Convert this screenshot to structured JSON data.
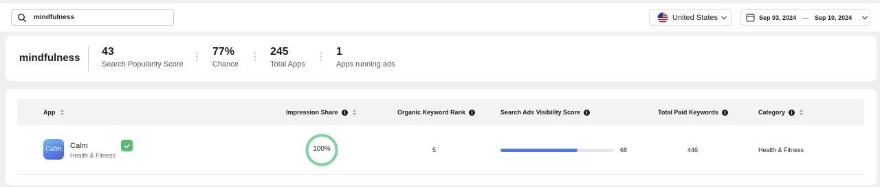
{
  "search": {
    "value": "mindfulness",
    "icon": "search-icon"
  },
  "country": {
    "label": "United States",
    "icon": "us-flag-icon"
  },
  "date_range": {
    "start": "Sep 03, 2024",
    "separator": "—",
    "end": "Sep 10, 2024"
  },
  "summary": {
    "keyword": "mindfulness",
    "metrics": [
      {
        "value": "43",
        "label": "Search Popularity Score"
      },
      {
        "value": "77%",
        "label": "Chance"
      },
      {
        "value": "245",
        "label": "Total Apps"
      },
      {
        "value": "1",
        "label": "Apps running ads"
      }
    ]
  },
  "table": {
    "columns": {
      "app": "App",
      "impression_share": "Impression Share",
      "organic_rank": "Organic Keyword Rank",
      "visibility": "Search Ads Visibility Score",
      "paid_keywords": "Total Paid Keywords",
      "category": "Category"
    },
    "rows": [
      {
        "icon_text": "Calm",
        "name": "Calm",
        "subtitle": "Health & Fitness",
        "impression_share": "100%",
        "impression_share_fraction": 1.0,
        "organic_rank": "5",
        "visibility_score": "68",
        "visibility_fraction": 0.68,
        "paid_keywords": "446",
        "category": "Health & Fitness"
      }
    ]
  },
  "colors": {
    "accent_blue": "#4b7be0",
    "ring_green": "#7fd3a0",
    "verified_green": "#5bb974"
  }
}
